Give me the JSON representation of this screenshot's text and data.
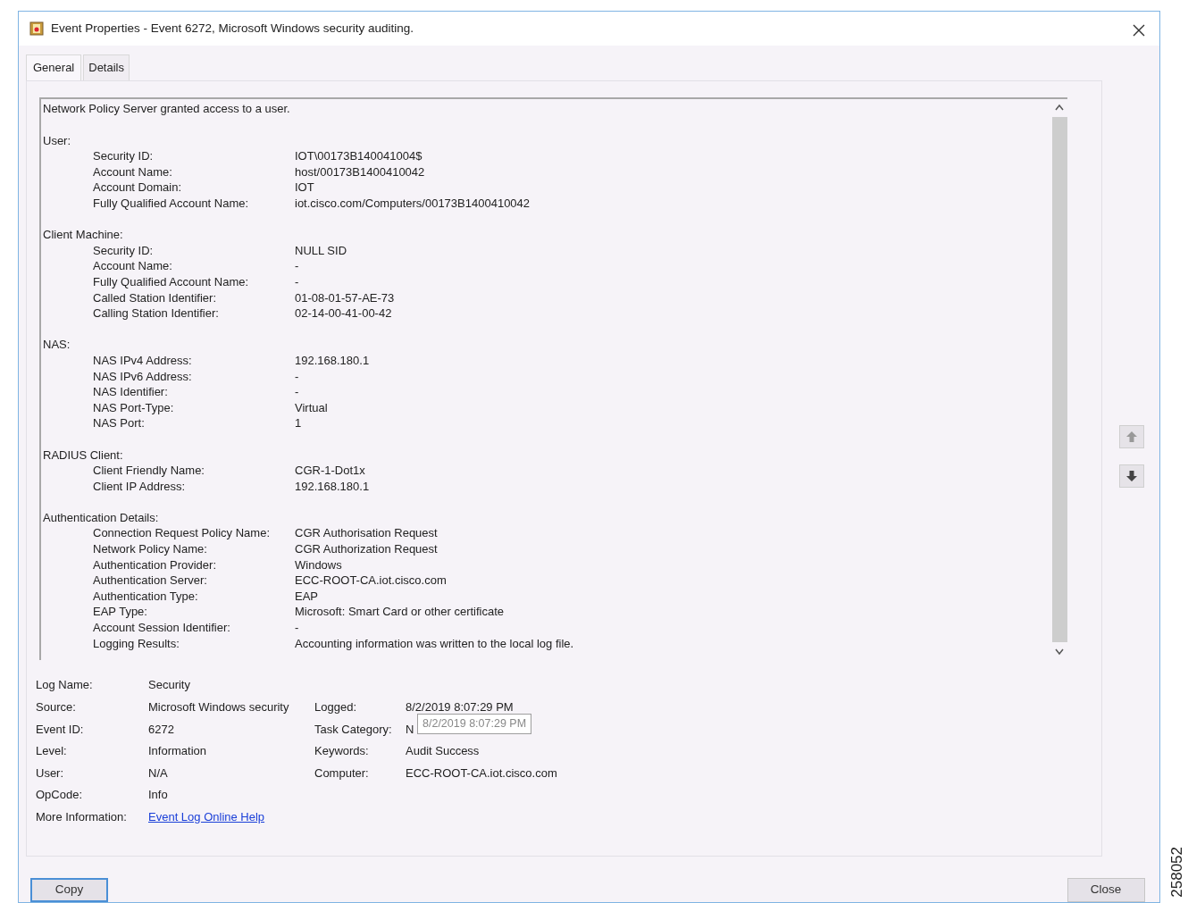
{
  "window": {
    "title": "Event Properties - Event 6272, Microsoft Windows security auditing."
  },
  "tabs": [
    {
      "label": "General",
      "selected": true
    },
    {
      "label": "Details",
      "selected": false
    }
  ],
  "description": {
    "summary": "Network Policy Server granted access to a user.",
    "sections": [
      {
        "title": "User:",
        "fields": [
          {
            "label": "Security ID:",
            "value": "IOT\\00173B140041004$"
          },
          {
            "label": "Account Name:",
            "value": "host/00173B1400410042"
          },
          {
            "label": "Account Domain:",
            "value": "IOT"
          },
          {
            "label": "Fully Qualified Account Name:",
            "value": "iot.cisco.com/Computers/00173B1400410042"
          }
        ]
      },
      {
        "title": "Client Machine:",
        "fields": [
          {
            "label": "Security ID:",
            "value": "NULL SID"
          },
          {
            "label": "Account Name:",
            "value": "-"
          },
          {
            "label": "Fully Qualified Account Name:",
            "value": "-"
          },
          {
            "label": "Called Station Identifier:",
            "value": "01-08-01-57-AE-73"
          },
          {
            "label": "Calling Station Identifier:",
            "value": "02-14-00-41-00-42"
          }
        ]
      },
      {
        "title": "NAS:",
        "fields": [
          {
            "label": "NAS IPv4 Address:",
            "value": "192.168.180.1"
          },
          {
            "label": "NAS IPv6 Address:",
            "value": "-"
          },
          {
            "label": "NAS Identifier:",
            "value": "-"
          },
          {
            "label": "NAS Port-Type:",
            "value": "Virtual"
          },
          {
            "label": "NAS Port:",
            "value": "1"
          }
        ]
      },
      {
        "title": "RADIUS Client:",
        "fields": [
          {
            "label": "Client Friendly Name:",
            "value": "CGR-1-Dot1x"
          },
          {
            "label": "Client IP Address:",
            "value": "192.168.180.1"
          }
        ]
      },
      {
        "title": "Authentication Details:",
        "fields": [
          {
            "label": "Connection Request Policy Name:",
            "value": "CGR Authorisation Request"
          },
          {
            "label": "Network Policy Name:",
            "value": "CGR Authorization Request"
          },
          {
            "label": "Authentication Provider:",
            "value": "Windows"
          },
          {
            "label": "Authentication Server:",
            "value": "ECC-ROOT-CA.iot.cisco.com"
          },
          {
            "label": "Authentication Type:",
            "value": "EAP"
          },
          {
            "label": "EAP Type:",
            "value": "Microsoft: Smart Card or other certificate"
          },
          {
            "label": "Account Session Identifier:",
            "value": "-"
          },
          {
            "label": "Logging Results:",
            "value": "Accounting information was written to the local log file."
          }
        ]
      }
    ]
  },
  "summary_rows": [
    {
      "kind": "text",
      "label": "Log Name:",
      "value": "Security"
    },
    {
      "kind": "text",
      "label": "Source:",
      "value": "Microsoft Windows security",
      "right_label": "Logged:",
      "right_value": "8/2/2019 8:07:29 PM"
    },
    {
      "kind": "text",
      "label": "Event ID:",
      "value": "6272",
      "right_label": "Task Category:",
      "right_value": "N"
    },
    {
      "kind": "text",
      "label": "Level:",
      "value": "Information",
      "right_label": "Keywords:",
      "right_value": "Audit Success"
    },
    {
      "kind": "text",
      "label": "User:",
      "value": "N/A",
      "right_label": "Computer:",
      "right_value": "ECC-ROOT-CA.iot.cisco.com"
    },
    {
      "kind": "text",
      "label": "OpCode:",
      "value": "Info"
    },
    {
      "kind": "link",
      "label": "More Information:",
      "value": "Event Log Online Help"
    }
  ],
  "tooltip": "8/2/2019 8:07:29 PM",
  "buttons": {
    "copy": "Copy",
    "close": "Close"
  },
  "figure_number": "258052"
}
